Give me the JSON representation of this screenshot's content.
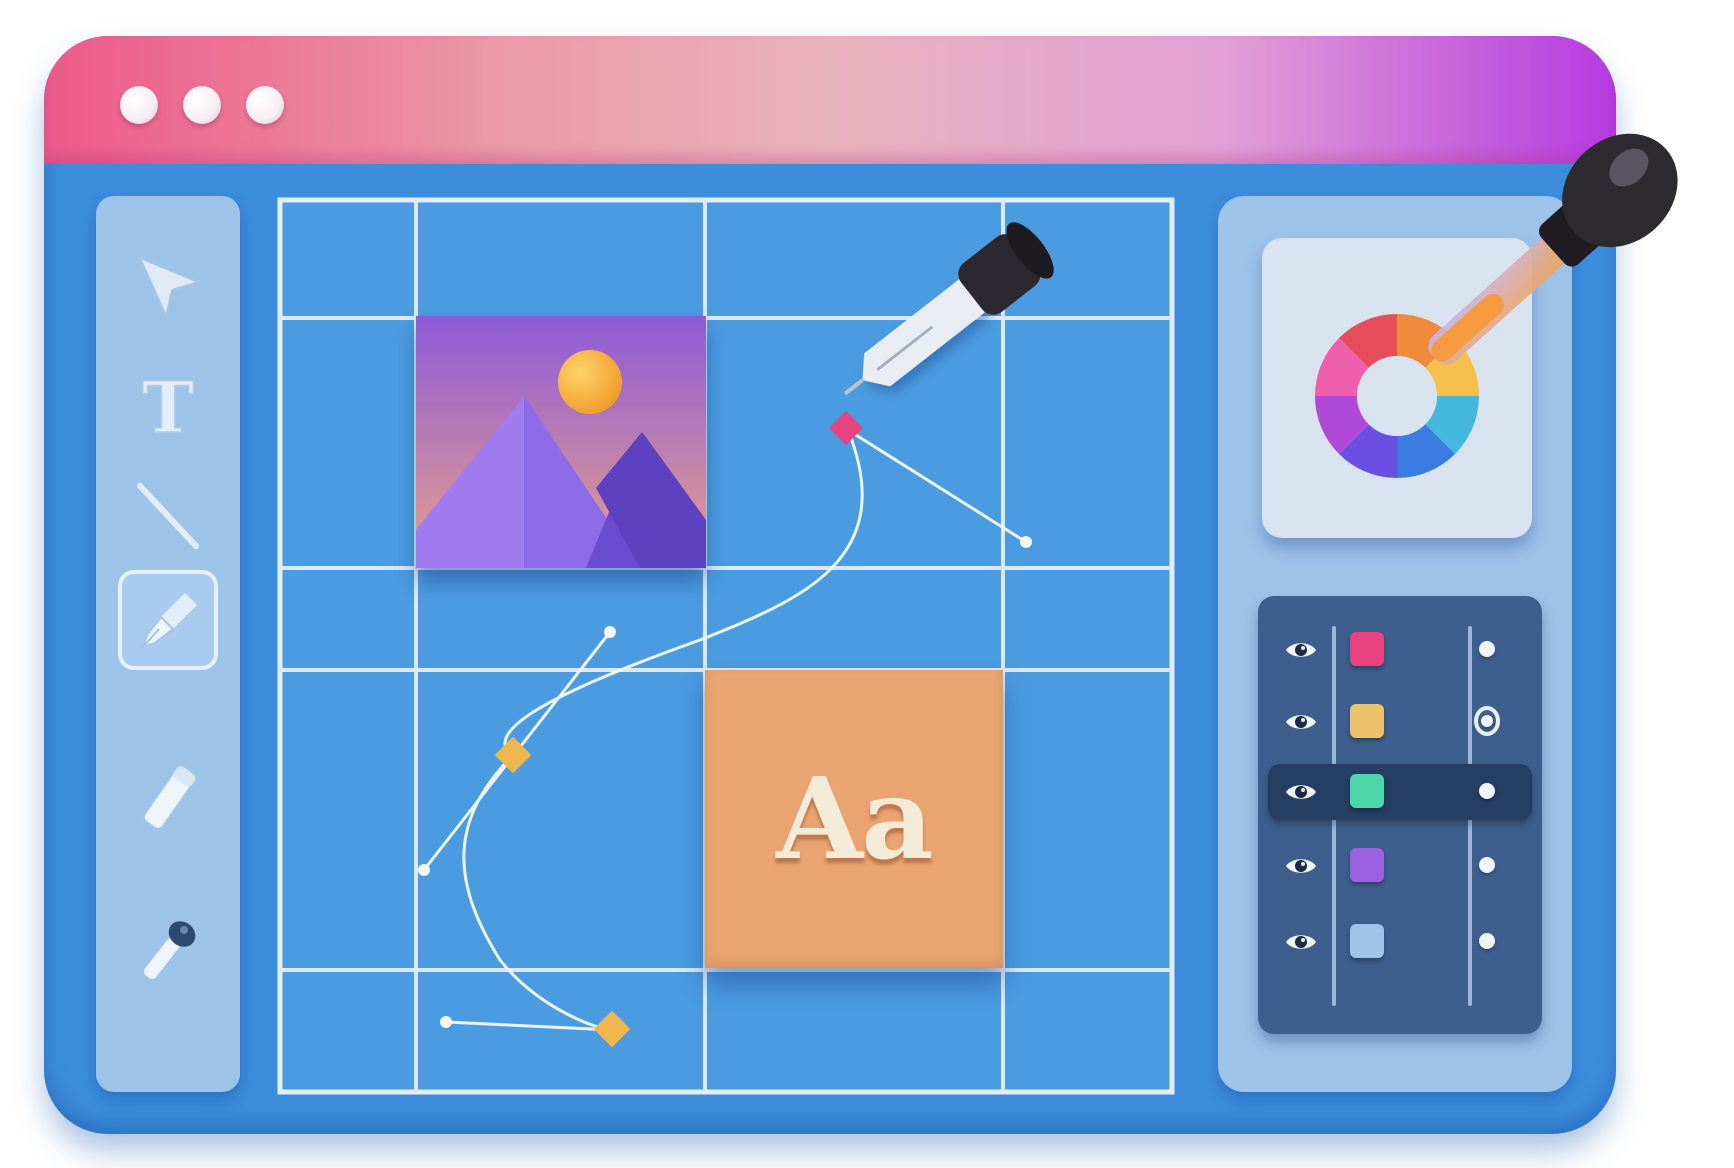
{
  "window": {
    "titlebar_colors": [
      "#ec5a8a",
      "#e9b3bd",
      "#b53be0"
    ],
    "controls": [
      "window-dot",
      "window-dot",
      "window-dot"
    ]
  },
  "toolbar": {
    "tools": [
      {
        "name": "pointer",
        "icon": "cursor-arrow-icon",
        "selected": false
      },
      {
        "name": "text",
        "icon": "text-tool-icon",
        "label": "T",
        "selected": false
      },
      {
        "name": "line",
        "icon": "line-tool-icon",
        "selected": false
      },
      {
        "name": "pen",
        "icon": "pen-nib-icon",
        "selected": true
      },
      {
        "name": "pencil",
        "icon": "pencil-icon",
        "selected": false
      },
      {
        "name": "eyedropper",
        "icon": "eyedropper-icon",
        "selected": false
      }
    ]
  },
  "canvas": {
    "grid_color": "#dbe9f7",
    "image_placeholder": {
      "icon": "image-mountain-icon"
    },
    "text_sample": {
      "label": "Aa",
      "color": "#e9a472"
    },
    "pen_path": {
      "icon": "pen-nib-icon"
    }
  },
  "color_panel": {
    "icon": "color-wheel-icon",
    "wheel_colors": [
      "#ef8a3b",
      "#f4c04a",
      "#44b7dd",
      "#3a7be0",
      "#6a4fe0",
      "#b049d8",
      "#ee5fae",
      "#e74c5c"
    ],
    "picker_icon": "eyedropper-icon"
  },
  "layers": {
    "items": [
      {
        "swatch": "#e8437e",
        "visible": true,
        "selected": false,
        "active": false
      },
      {
        "swatch": "#ecc36a",
        "visible": true,
        "selected": true,
        "active": false
      },
      {
        "swatch": "#4fd6a8",
        "visible": true,
        "selected": false,
        "active": true
      },
      {
        "swatch": "#9a62e0",
        "visible": true,
        "selected": false,
        "active": false
      },
      {
        "swatch": "#9ec4e9",
        "visible": true,
        "selected": false,
        "active": false
      }
    ]
  }
}
